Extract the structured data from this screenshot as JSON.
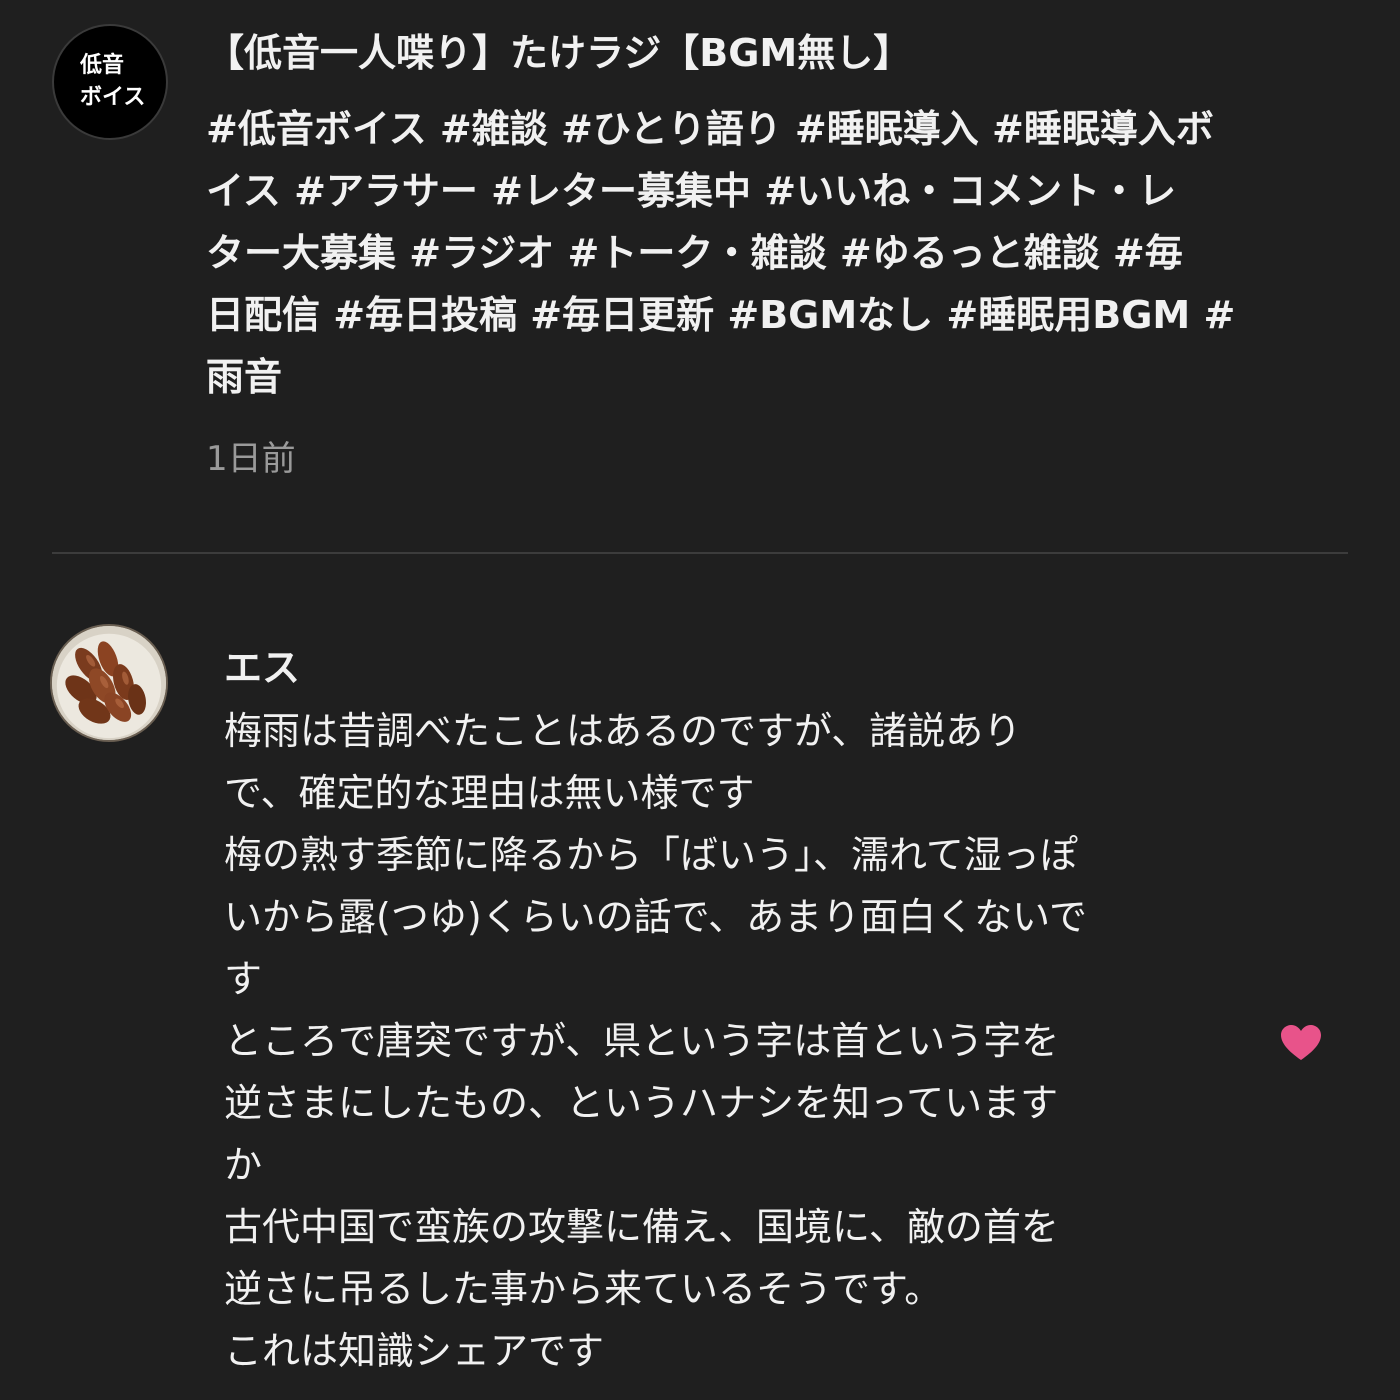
{
  "post": {
    "channel_avatar_lines": [
      "低音",
      "ボイス"
    ],
    "title": "【低音一人喋り】たけラジ【BGM無し】",
    "body_lines": [
      " #低音ボイス #雑談 #ひとり語り #睡眠導入 #睡眠導入ボ",
      "イス #アラサー #レター募集中 #いいね・コメント・レ",
      "ター大募集 #ラジオ #トーク・雑談 #ゆるっと雑談 #毎",
      "日配信 #毎日投稿 #毎日更新  #BGMなし #睡眠用BGM #",
      "雨音"
    ],
    "time": "1日前"
  },
  "comment": {
    "author": "エス",
    "text_lines": [
      "梅雨は昔調べたことはあるのですが、諸説あり",
      "で、確定的な理由は無い様です",
      "梅の熟す季節に降るから「ばいう」、濡れて湿っぽ",
      "いから露(つゆ)くらいの話で、あまり面白くないで",
      "す",
      "ところで唐突ですが、県という字は首という字を",
      "逆さまにしたもの、というハナシを知っています",
      "か",
      "古代中国で蛮族の攻撃に備え、国境に、敵の首を",
      "逆さに吊るした事から来ているそうです。",
      "これは知識シェアです"
    ],
    "heart_icon": "heart-icon",
    "heart_color": "#e8538a"
  },
  "colors": {
    "background": "#1f1f1f",
    "text": "#f1f1f1",
    "secondary_text": "#9a9a9a",
    "divider": "#3c3c3c"
  }
}
